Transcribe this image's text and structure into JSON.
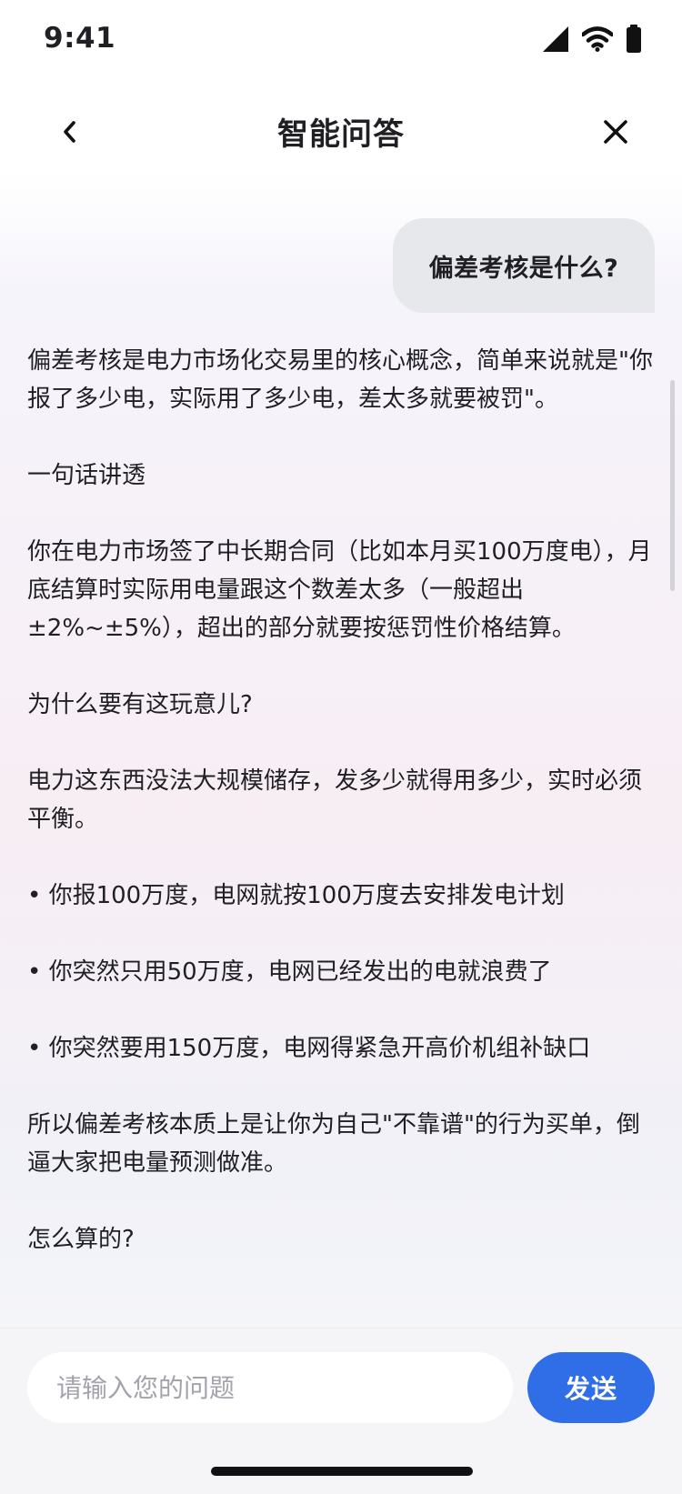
{
  "status_bar": {
    "time": "9:41",
    "icons": [
      "signal-icon",
      "wifi-icon",
      "battery-icon"
    ]
  },
  "header": {
    "title": "智能问答",
    "back_icon": "chevron-left-icon",
    "close_icon": "close-icon"
  },
  "chat": {
    "user_message": "偏差考核是什么?",
    "answer_paragraphs": [
      "偏差考核是电力市场化交易里的核心概念，简单来说就是\"你报了多少电，实际用了多少电，差太多就要被罚\"。",
      "一句话讲透",
      "你在电力市场签了中长期合同（比如本月买100万度电），月底结算时实际用电量跟这个数差太多（一般超出±2%~±5%），超出的部分就要按惩罚性价格结算。",
      "为什么要有这玩意儿?",
      "电力这东西没法大规模储存，发多少就得用多少，实时必须平衡。",
      "• 你报100万度，电网就按100万度去安排发电计划",
      "• 你突然只用50万度，电网已经发出的电就浪费了",
      "• 你突然要用150万度，电网得紧急开高价机组补缺口",
      "所以偏差考核本质上是让你为自己\"不靠谱\"的行为买单，倒逼大家把电量预测做准。",
      "怎么算的?"
    ]
  },
  "input_bar": {
    "placeholder": "请输入您的问题",
    "value": "",
    "send_label": "发送"
  },
  "colors": {
    "accent": "#2f6ee6",
    "user_bubble": "#e7e8ec",
    "input_bar_bg": "#f5f5f8"
  }
}
